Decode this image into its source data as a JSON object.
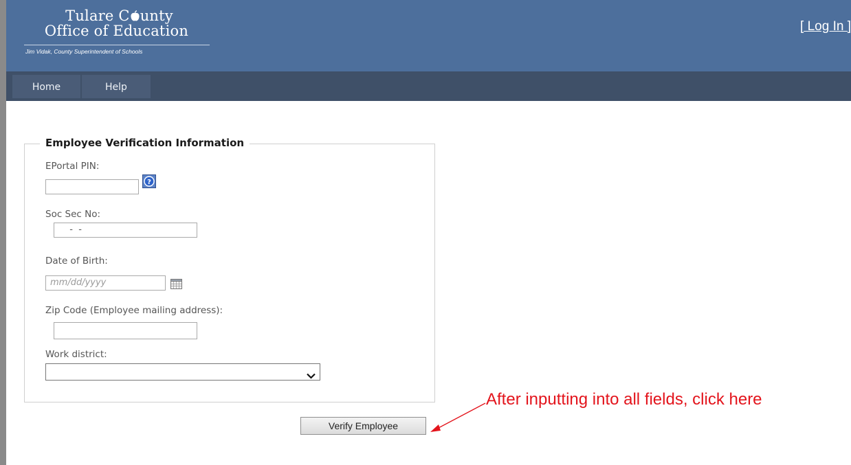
{
  "header": {
    "logo_line1_part1": "Tulare C",
    "logo_line1_part2": "unty",
    "logo_line2": "Office of Education",
    "logo_subtitle": "Jim Vidak, County Superintendent of Schools",
    "login_link": "[ Log In ]",
    "background_color": "#4d6f9c"
  },
  "nav": {
    "items": [
      {
        "label": "Home"
      },
      {
        "label": "Help"
      }
    ],
    "background_color": "#3f5068"
  },
  "form": {
    "legend": "Employee Verification Information",
    "eportal_pin": {
      "label": "EPortal PIN:",
      "value": ""
    },
    "ssn": {
      "label": "Soc Sec No:",
      "value": "  -  -"
    },
    "dob": {
      "label": "Date of Birth:",
      "placeholder": "mm/dd/yyyy"
    },
    "zip": {
      "label": "Zip Code (Employee mailing address):",
      "value": ""
    },
    "district": {
      "label": "Work district:",
      "selected": ""
    },
    "submit_label": "Verify Employee"
  },
  "annotation": {
    "text": "After inputting into all fields, click here",
    "color": "#e3141c"
  },
  "icons": {
    "help": "help-question-icon",
    "calendar": "calendar-icon",
    "dropdown": "chevron-down-icon",
    "logo_apple": "apple-icon"
  }
}
